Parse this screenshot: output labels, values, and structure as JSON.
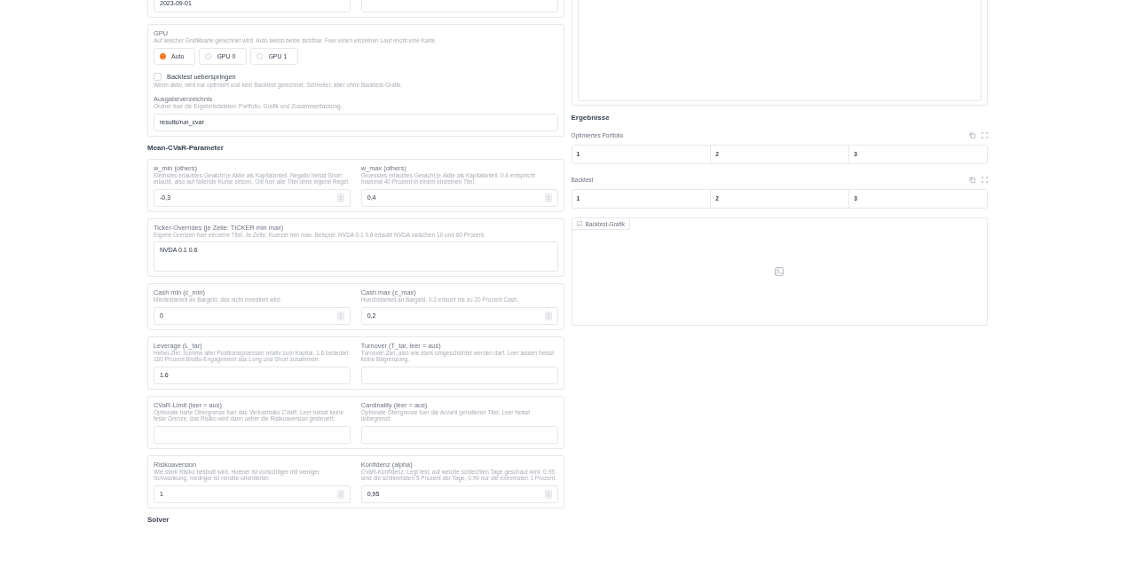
{
  "date_field": {
    "value": "2023-09-01"
  },
  "gpu": {
    "label": "GPU",
    "description": "Auf welcher Grafikkarte gerechnet wird. Auto laesst beide sichtbar. Fuer einen einzelnen Lauf reicht eine Karte.",
    "options": [
      {
        "label": "Auto",
        "selected": true
      },
      {
        "label": "GPU 0",
        "selected": false
      },
      {
        "label": "GPU 1",
        "selected": false
      }
    ]
  },
  "skip_backtest": {
    "label": "Backtest ueberspringen",
    "checked": false,
    "description": "Wenn aktiv, wird nur optimiert und kein Backtest gerechnet. Schneller, aber ohne Backtest-Grafik."
  },
  "output_dir": {
    "label": "Ausgabeverzeichnis",
    "description": "Ordner fuer die Ergebnisdateien: Portfolio, Grafik und Zusammenfassung.",
    "value": "results/run_cvar"
  },
  "mean_cvar": {
    "heading": "Mean-CVaR-Parameter",
    "groups": [
      {
        "fields": [
          {
            "kind": "number",
            "label": "w_min (others)",
            "description": "Kleinstes erlaubtes Gewicht je Aktie als Kapitalanteil. Negativ heisst Short erlaubt, also auf fallende Kurse setzen. Gilt fuer alle Titel ohne eigene Regel.",
            "value": "-0,3"
          },
          {
            "kind": "number",
            "label": "w_max (others)",
            "description": "Groesstes erlaubtes Gewicht je Aktie als Kapitalanteil. 0.4 entspricht maximal 40 Prozent in einem einzelnen Titel.",
            "value": "0,4"
          }
        ]
      },
      {
        "fields": [
          {
            "kind": "textarea",
            "label": "Ticker-Overrides (je Zeile: TICKER min max)",
            "description": "Eigene Grenzen fuer einzelne Titel. Je Zeile: Kuerzel min max. Beispiel: NVDA 0.1 0.6 erlaubt NVDA zwischen 10 und 60 Prozent.",
            "value": "NVDA 0.1 0.6"
          }
        ]
      },
      {
        "fields": [
          {
            "kind": "number",
            "label": "Cash min (c_min)",
            "description": "Mindestanteil an Bargeld, das nicht investiert wird.",
            "value": "0"
          },
          {
            "kind": "number",
            "label": "Cash max (c_max)",
            "description": "Hoechstanteil an Bargeld. 0.2 erlaubt bis zu 20 Prozent Cash.",
            "value": "0,2"
          }
        ]
      },
      {
        "fields": [
          {
            "kind": "text",
            "label": "Leverage (L_tar)",
            "description": "Hebel-Ziel. Summe aller Positionsgroessen relativ zum Kapital. 1.6 bedeutet 160 Prozent Brutto-Engagement aus Long und Short zusammen.",
            "value": "1.6"
          },
          {
            "kind": "text",
            "label": "Turnover (T_tar, leer = aus)",
            "description": "Turnover-Ziel, also wie stark umgeschichtet werden darf. Leer lassen heisst keine Begrenzung."
          }
        ]
      },
      {
        "fields": [
          {
            "kind": "text",
            "label": "CVaR-Limit (leer = aus)",
            "description": "Optionale harte Obergrenze fuer das Verlustrisiko CVaR. Leer heisst keine feste Grenze, das Risiko wird dann ueber die Risikoaversion gesteuert."
          },
          {
            "kind": "text",
            "label": "Cardinality (leer = aus)",
            "description": "Optionale Obergrenze fuer die Anzahl gehaltener Titel. Leer heisst unbegrenzt."
          }
        ]
      },
      {
        "fields": [
          {
            "kind": "number",
            "label": "Risikoaversion",
            "description": "Wie stark Risiko bestraft wird. Hoeher ist vorsichtiger mit weniger Schwankung, niedriger ist rendite-orientierter.",
            "value": "1"
          },
          {
            "kind": "number",
            "label": "Konfidenz (alpha)",
            "description": "CVaR-Konfidenz. Legt fest, auf welche schlechten Tage geschaut wird. 0.95 sind die schlimmsten 5 Prozent der Tage, 0.99 nur die extremsten 1 Prozent.",
            "value": "0,95"
          }
        ]
      }
    ]
  },
  "solver_heading": "Solver",
  "results": {
    "heading": "Ergebnisse",
    "tables": [
      {
        "label": "Optimiertes Portfolio",
        "columns": [
          "1",
          "2",
          "3"
        ]
      },
      {
        "label": "Backtest",
        "columns": [
          "1",
          "2",
          "3"
        ]
      }
    ],
    "image": {
      "label": "Backtest-Grafik"
    }
  }
}
